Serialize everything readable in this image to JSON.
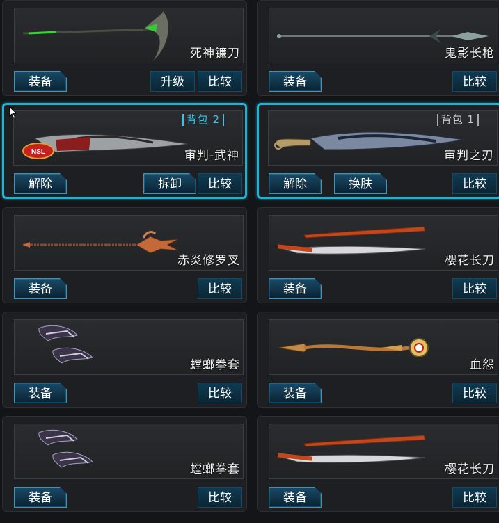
{
  "colors": {
    "accent": "#19b6d6",
    "button": "#1e4a60",
    "panel": "#1d1f22"
  },
  "items": [
    {
      "name": "死神镰刀",
      "icon": "scythe-icon",
      "buttons": [
        {
          "label": "装备",
          "kind": "primary"
        },
        {
          "label": "升级",
          "kind": "small"
        },
        {
          "label": "比较",
          "kind": "small"
        }
      ]
    },
    {
      "name": "鬼影长枪",
      "icon": "spear-icon",
      "buttons": [
        {
          "label": "装备",
          "kind": "primary"
        },
        {
          "label": "比较",
          "kind": "small"
        }
      ]
    },
    {
      "name": "审判-武神",
      "icon": "blade-nsl-icon",
      "bag": "背包 2",
      "equipped": true,
      "buttons": [
        {
          "label": "解除",
          "kind": "primary"
        },
        {
          "label": "拆卸",
          "kind": "primary"
        },
        {
          "label": "比较",
          "kind": "small"
        }
      ]
    },
    {
      "name": "审判之刃",
      "icon": "blade-icon",
      "bag": "背包 1",
      "equipped": true,
      "buttons": [
        {
          "label": "解除",
          "kind": "primary"
        },
        {
          "label": "换肤",
          "kind": "primary"
        },
        {
          "label": "比较",
          "kind": "small"
        }
      ]
    },
    {
      "name": "赤炎修罗叉",
      "icon": "trident-icon",
      "buttons": [
        {
          "label": "装备",
          "kind": "primary"
        },
        {
          "label": "比较",
          "kind": "small"
        }
      ]
    },
    {
      "name": "樱花长刀",
      "icon": "katana-icon",
      "buttons": [
        {
          "label": "装备",
          "kind": "primary"
        },
        {
          "label": "比较",
          "kind": "small"
        }
      ]
    },
    {
      "name": "螳螂拳套",
      "icon": "gauntlet-icon",
      "buttons": [
        {
          "label": "装备",
          "kind": "primary"
        },
        {
          "label": "比较",
          "kind": "small"
        }
      ]
    },
    {
      "name": "血怨",
      "icon": "staff-icon",
      "buttons": [
        {
          "label": "装备",
          "kind": "primary"
        },
        {
          "label": "比较",
          "kind": "small"
        }
      ]
    },
    {
      "name": "螳螂拳套",
      "icon": "gauntlet-icon",
      "buttons": [
        {
          "label": "装备",
          "kind": "primary"
        },
        {
          "label": "比较",
          "kind": "small"
        }
      ]
    },
    {
      "name": "樱花长刀",
      "icon": "katana-icon",
      "buttons": [
        {
          "label": "装备",
          "kind": "primary"
        },
        {
          "label": "比较",
          "kind": "small"
        }
      ]
    }
  ]
}
